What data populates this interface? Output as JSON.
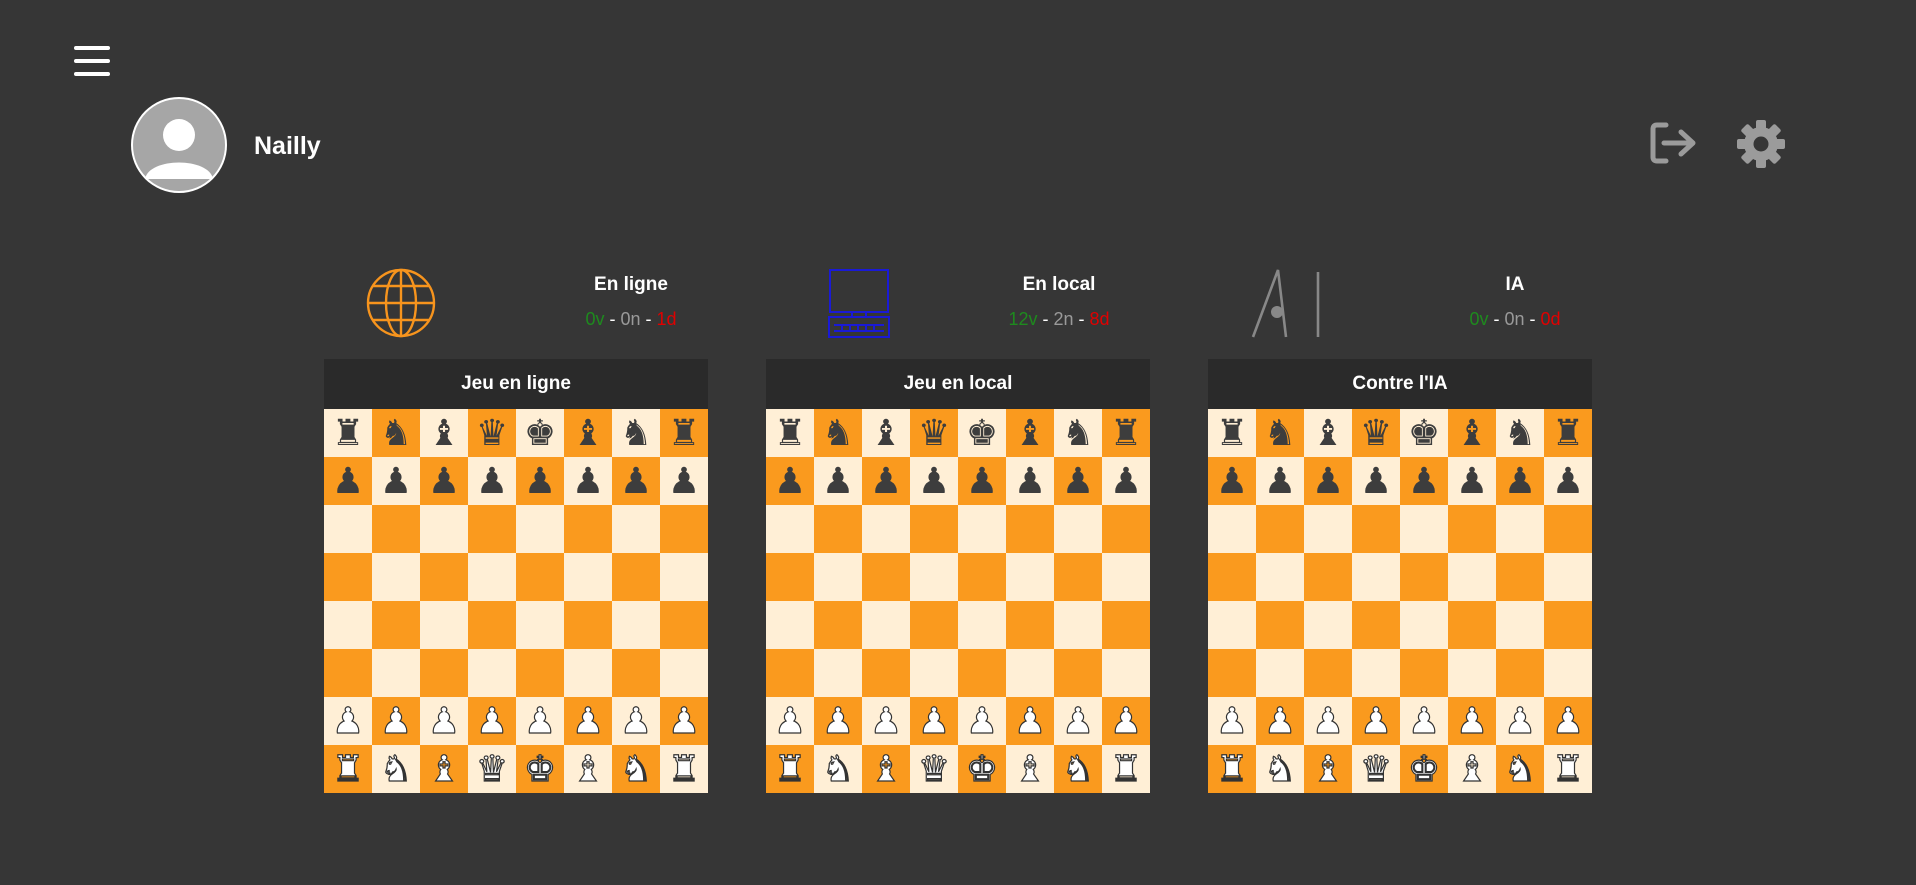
{
  "user": {
    "name": "Nailly"
  },
  "modes": [
    {
      "icon": "globe-icon",
      "title": "En ligne",
      "wins": "0v",
      "draws": "0n",
      "losses": "1d",
      "board_title": "Jeu en ligne"
    },
    {
      "icon": "computer-icon",
      "title": "En local",
      "wins": "12v",
      "draws": "2n",
      "losses": "8d",
      "board_title": "Jeu en local"
    },
    {
      "icon": "ai-icon",
      "title": "IA",
      "wins": "0v",
      "draws": "0n",
      "losses": "0d",
      "board_title": "Contre l'IA"
    }
  ],
  "stats_separator": " - ",
  "colors": {
    "background": "#363636",
    "light_square": "#ffefd6",
    "dark_square": "#fa9a1e",
    "board_header": "#2a2a2a",
    "win": "#1e8a1e",
    "draw": "#9a9a9a",
    "loss": "#e00000",
    "online_icon": "#f7941d",
    "local_icon": "#1a1ad6",
    "ai_icon": "#888888"
  },
  "board": {
    "rows": [
      [
        "♜",
        "♞",
        "♝",
        "♛",
        "♚",
        "♝",
        "♞",
        "♜"
      ],
      [
        "♟",
        "♟",
        "♟",
        "♟",
        "♟",
        "♟",
        "♟",
        "♟"
      ],
      [
        "",
        "",
        "",
        "",
        "",
        "",
        "",
        ""
      ],
      [
        "",
        "",
        "",
        "",
        "",
        "",
        "",
        ""
      ],
      [
        "",
        "",
        "",
        "",
        "",
        "",
        "",
        ""
      ],
      [
        "",
        "",
        "",
        "",
        "",
        "",
        "",
        ""
      ],
      [
        "♙",
        "♙",
        "♙",
        "♙",
        "♙",
        "♙",
        "♙",
        "♙"
      ],
      [
        "♖",
        "♘",
        "♗",
        "♕",
        "♔",
        "♗",
        "♘",
        "♖"
      ]
    ]
  }
}
